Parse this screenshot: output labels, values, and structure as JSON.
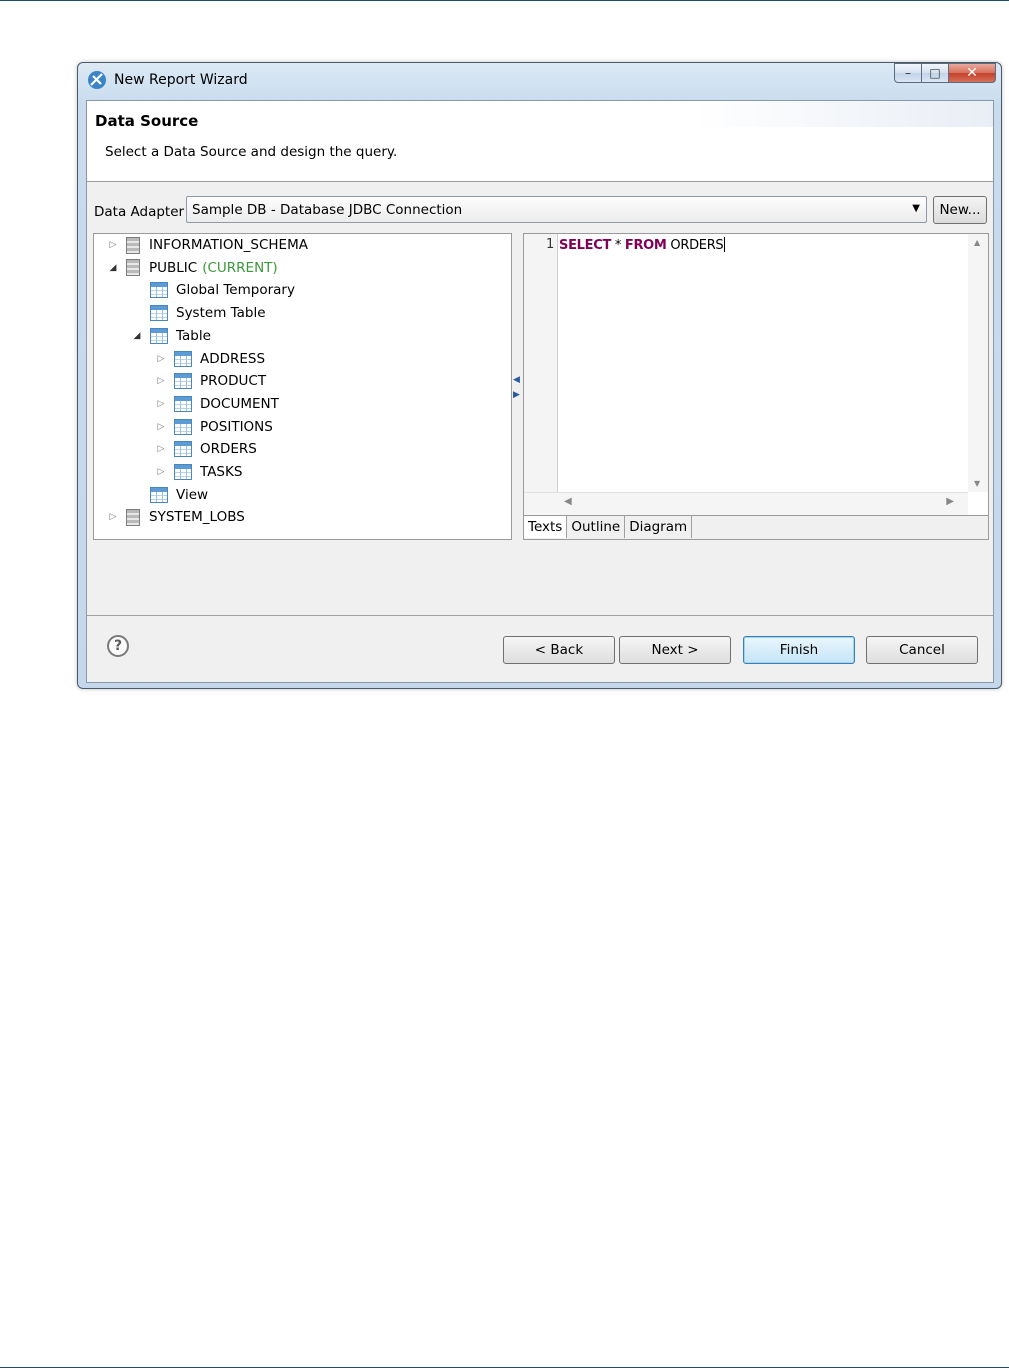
{
  "window": {
    "title": "New Report Wizard"
  },
  "header": {
    "title": "Data Source",
    "description": "Select a Data Source and design the query."
  },
  "adapter": {
    "label": "Data Adapter",
    "value": "Sample DB - Database JDBC Connection",
    "new_label": "New..."
  },
  "tree": {
    "items": [
      {
        "label": "INFORMATION_SCHEMA",
        "icon": "database-icon",
        "state": "collapsed",
        "depth": 0
      },
      {
        "label": "PUBLIC",
        "suffix": "(CURRENT)",
        "icon": "database-icon",
        "state": "expanded",
        "depth": 0
      },
      {
        "label": "Global Temporary",
        "icon": "table-icon",
        "state": "leaf",
        "depth": 1
      },
      {
        "label": "System Table",
        "icon": "table-icon",
        "state": "leaf",
        "depth": 1
      },
      {
        "label": "Table",
        "icon": "table-icon",
        "state": "expanded",
        "depth": 1
      },
      {
        "label": "ADDRESS",
        "icon": "table-icon",
        "state": "collapsed",
        "depth": 2
      },
      {
        "label": "PRODUCT",
        "icon": "table-icon",
        "state": "collapsed",
        "depth": 2
      },
      {
        "label": "DOCUMENT",
        "icon": "table-icon",
        "state": "collapsed",
        "depth": 2
      },
      {
        "label": "POSITIONS",
        "icon": "table-icon",
        "state": "collapsed",
        "depth": 2
      },
      {
        "label": "ORDERS",
        "icon": "table-icon",
        "state": "collapsed",
        "depth": 2
      },
      {
        "label": "TASKS",
        "icon": "table-icon",
        "state": "collapsed",
        "depth": 2
      },
      {
        "label": "View",
        "icon": "table-icon",
        "state": "leaf",
        "depth": 1
      },
      {
        "label": "SYSTEM_LOBS",
        "icon": "database-icon",
        "state": "collapsed",
        "depth": 0
      }
    ]
  },
  "editor": {
    "line_number": "1",
    "query": {
      "kw1": "SELECT",
      "mid": " * ",
      "kw2": "FROM",
      "rest": " ORDERS"
    },
    "tabs": [
      "Texts",
      "Outline",
      "Diagram"
    ],
    "active_tab": "Texts"
  },
  "footer": {
    "back": "< Back",
    "next": "Next >",
    "finish": "Finish",
    "cancel": "Cancel"
  },
  "colors": {
    "keyword": "#7f0055",
    "current": "#3a9a3a",
    "accent": "#3c7fb1"
  }
}
